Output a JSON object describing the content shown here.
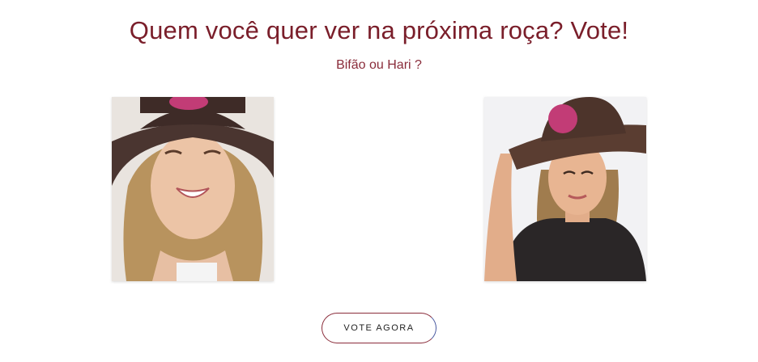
{
  "header": {
    "title": "Quem você quer ver na próxima roça? Vote!",
    "subtitle": "Bifão ou Hari ?"
  },
  "candidates": [
    {
      "icon": "candidate-photo-bifao"
    },
    {
      "icon": "candidate-photo-hari"
    }
  ],
  "actions": {
    "vote_label": "VOTE AGORA"
  },
  "colors": {
    "title": "#7a1e2a",
    "button_border_start": "#8a2c3a",
    "button_border_end": "#4a5aa0"
  }
}
